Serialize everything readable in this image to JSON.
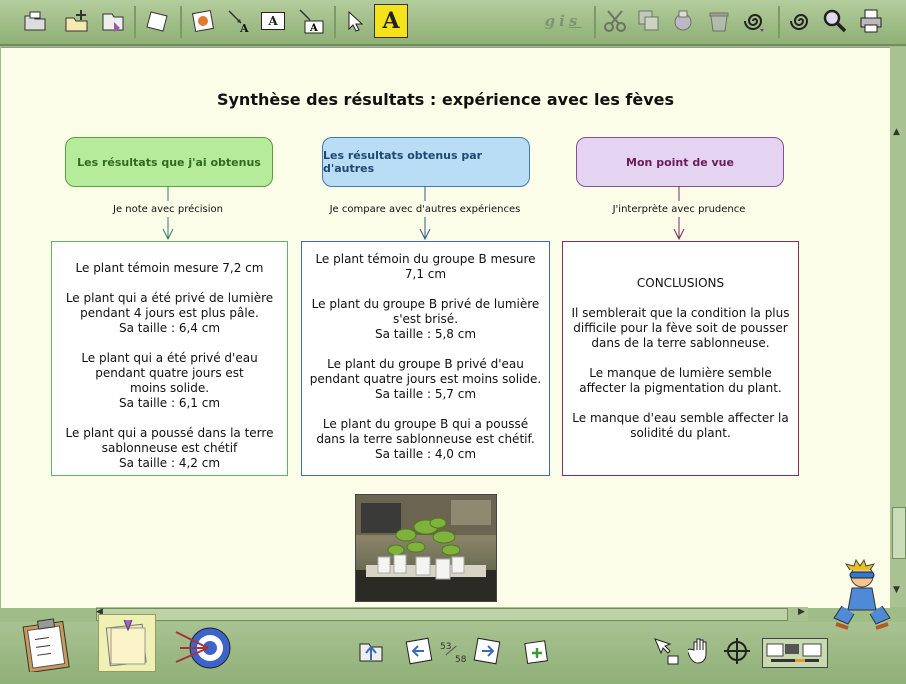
{
  "toolbar": {
    "icons": [
      "open-icon",
      "add-page-icon",
      "save-icon",
      "blank-page-icon",
      "image-icon",
      "arrow-text-icon",
      "textbox-icon",
      "arrow-textbox-icon",
      "pointer-icon",
      "text-tool-icon",
      "format-text-icon",
      "cut-icon",
      "copy-icon",
      "paste-icon",
      "trash-icon",
      "spiral-menu-icon",
      "spiral-icon",
      "search-icon",
      "print-icon"
    ],
    "format_labels": {
      "bold": "g",
      "italic": "i",
      "underline": "s"
    },
    "text_tool_label": "A",
    "textbox_label": "A"
  },
  "page": {
    "title": "Synthèse des résultats : expérience avec les fèves",
    "columns": [
      {
        "header": "Les résultats que j'ai obtenus",
        "subtitle": "Je note avec précision",
        "lines": [
          "Le plant témoin mesure 7,2 cm",
          "",
          "Le plant qui a été privé de lumière",
          "pendant 4 jours est plus pâle.",
          "Sa taille : 6,4 cm",
          "",
          "Le plant qui a été privé d'eau",
          "pendant quatre jours est",
          "moins solide.",
          "Sa taille : 6,1 cm",
          "",
          "Le plant qui a poussé dans la terre",
          "sablonneuse est chétif",
          "Sa taille : 4,2 cm"
        ]
      },
      {
        "header": "Les résultats obtenus par d'autres",
        "subtitle": "Je compare avec d'autres expériences",
        "lines": [
          "Le plant témoin du groupe B mesure",
          "7,1 cm",
          "",
          "Le plant du groupe B privé de lumière",
          "s'est brisé.",
          "Sa taille : 5,8 cm",
          "",
          "Le plant du groupe B privé d'eau",
          "pendant quatre jours est moins solide.",
          "Sa taille : 5,7 cm",
          "",
          "Le plant du groupe B qui a poussé",
          "dans la terre sablonneuse est chétif.",
          "Sa taille : 4,0 cm"
        ]
      },
      {
        "header": "Mon point de vue",
        "subtitle": "J'interprète avec prudence",
        "lines": [
          "CONCLUSIONS",
          "",
          "Il semblerait que la condition la plus",
          "difficile pour la fève soit de pousser",
          "dans de la terre sablonneuse.",
          "",
          "Le manque de lumière semble",
          "affecter la pigmentation du plant.",
          "",
          "Le manque d'eau semble affecter la",
          "solidité du plant."
        ]
      }
    ]
  },
  "colors": {
    "green": "#55a23c",
    "blue": "#3f7ab0",
    "purple": "#8a2c5a"
  },
  "bottom": {
    "page_current": "53",
    "page_total": "58",
    "icons": [
      "clipboard-checklist-icon",
      "notes-icon",
      "target-icon",
      "import-icon",
      "prev-page-icon",
      "next-page-icon",
      "new-page-icon",
      "pointer-hand-icon",
      "hand-icon",
      "crosshair-icon",
      "overview-icon"
    ]
  }
}
